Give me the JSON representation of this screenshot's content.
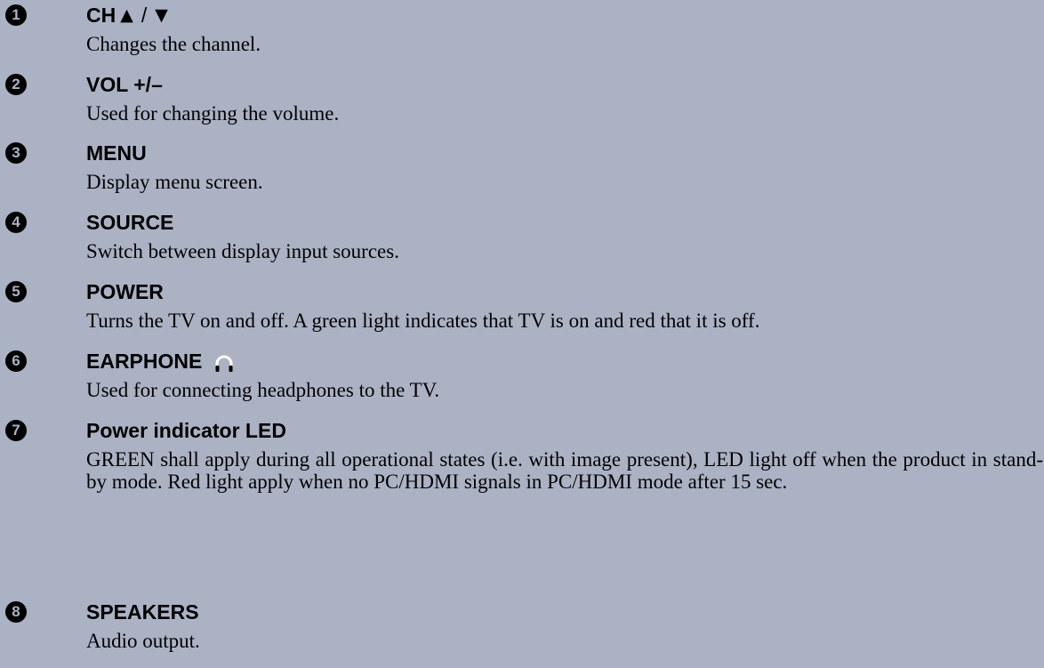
{
  "items": [
    {
      "number": "1",
      "title_prefix": "CH",
      "up_symbol": "▲",
      "separator": "/",
      "down_symbol": "▼",
      "description": "Changes the channel."
    },
    {
      "number": "2",
      "title": "VOL +/–",
      "description": "Used for changing the volume."
    },
    {
      "number": "3",
      "title": "MENU",
      "description": "Display menu screen."
    },
    {
      "number": "4",
      "title": "SOURCE",
      "description": "Switch between display input sources."
    },
    {
      "number": "5",
      "title": "POWER",
      "description": "Turns the TV on and off. A green light indicates that TV is on and red that it is off."
    },
    {
      "number": "6",
      "title": "EARPHONE",
      "icon": "headphone-icon",
      "description": "Used for connecting headphones to the TV."
    },
    {
      "number": "7",
      "title": "Power indicator LED",
      "description": "GREEN shall apply during all operational states (i.e. with image present), LED light off when the product in stand-by mode. Red light apply when no PC/HDMI signals in PC/HDMI mode after 15 sec."
    },
    {
      "number": "8",
      "title": "SPEAKERS",
      "description": "Audio output."
    }
  ],
  "colors": {
    "background": "#abb2c4",
    "text": "#000000"
  }
}
